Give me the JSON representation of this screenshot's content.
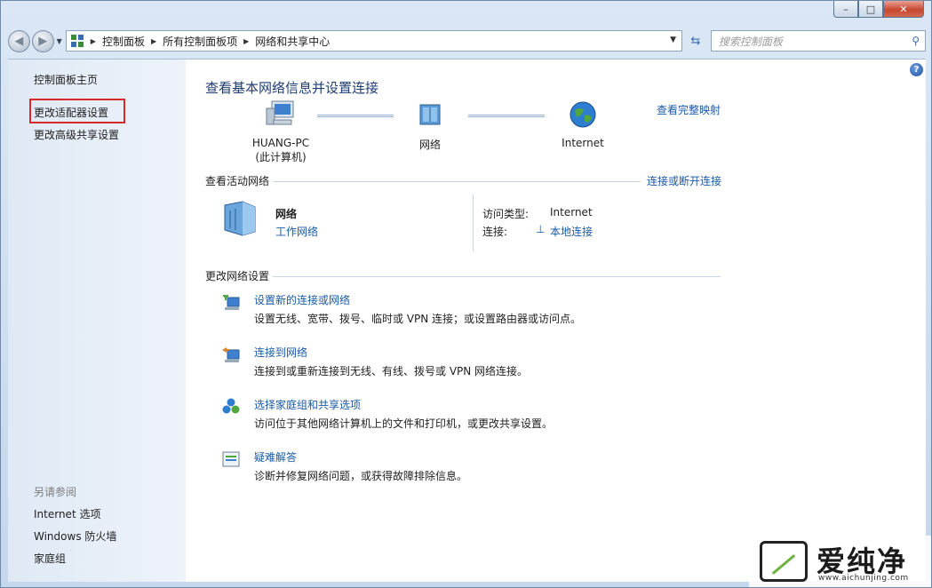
{
  "window": {
    "minimize_glyph": "–",
    "maximize_glyph": "□",
    "close_glyph": "✕"
  },
  "navbar": {
    "back_glyph": "◀",
    "forward_glyph": "▶",
    "breadcrumbs": [
      "控制面板",
      "所有控制面板项",
      "网络和共享中心"
    ],
    "search_placeholder": "搜索控制面板"
  },
  "sidebar": {
    "home": "控制面板主页",
    "links": [
      "更改适配器设置",
      "更改高级共享设置"
    ],
    "see_also_label": "另请参阅",
    "see_also": [
      "Internet 选项",
      "Windows 防火墙",
      "家庭组"
    ]
  },
  "main": {
    "title": "查看基本网络信息并设置连接",
    "full_map_link": "查看完整映射",
    "map": {
      "computer_name": "HUANG-PC",
      "computer_sub": "(此计算机)",
      "network": "网络",
      "internet": "Internet"
    },
    "active": {
      "section_title": "查看活动网络",
      "connect_link": "连接或断开连接",
      "network_name": "网络",
      "network_type": "工作网络",
      "access_type_label": "访问类型:",
      "access_type_value": "Internet",
      "connection_label": "连接:",
      "connection_value": "本地连接"
    },
    "change": {
      "section_title": "更改网络设置",
      "tasks": [
        {
          "title": "设置新的连接或网络",
          "desc": "设置无线、宽带、拨号、临时或 VPN 连接；或设置路由器或访问点。",
          "icon": "new-connection-icon"
        },
        {
          "title": "连接到网络",
          "desc": "连接到或重新连接到无线、有线、拨号或 VPN 网络连接。",
          "icon": "connect-network-icon"
        },
        {
          "title": "选择家庭组和共享选项",
          "desc": "访问位于其他网络计算机上的文件和打印机，或更改共享设置。",
          "icon": "homegroup-icon"
        },
        {
          "title": "疑难解答",
          "desc": "诊断并修复网络问题，或获得故障排除信息。",
          "icon": "troubleshoot-icon"
        }
      ]
    }
  },
  "watermark": {
    "text": "爱纯净",
    "url": "www.aichunjing.com"
  }
}
